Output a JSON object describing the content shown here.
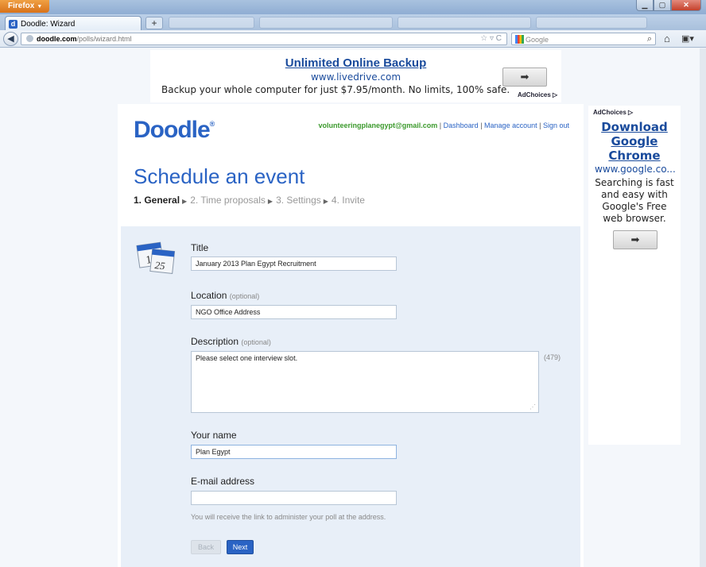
{
  "browser": {
    "menu_label": "Firefox",
    "active_tab_title": "Doodle: Wizard",
    "new_tab_symbol": "+",
    "url_domain": "doodle.com",
    "url_path": "/polls/wizard.html",
    "search_placeholder": "Google"
  },
  "top_ad": {
    "title": "Unlimited Online Backup",
    "url": "www.livedrive.com",
    "description": "Backup your whole computer for just $7.95/month. No limits, 100% safe.",
    "adchoices": "AdChoices"
  },
  "doodle": {
    "logo": "Doodle",
    "account": {
      "email": "volunteeringplanegypt@gmail.com",
      "dashboard": "Dashboard",
      "manage": "Manage account",
      "signout": "Sign out",
      "sep": "|"
    },
    "heading": "Schedule an event",
    "steps": [
      "1. General",
      "2. Time proposals",
      "3. Settings",
      "4. Invite"
    ],
    "calendar_numbers": [
      "1",
      "25"
    ],
    "form": {
      "title_label": "Title",
      "title_value": "January 2013 Plan Egypt Recruitment",
      "location_label": "Location",
      "location_optional": "(optional)",
      "location_value": "NGO Office Address",
      "description_label": "Description",
      "description_optional": "(optional)",
      "description_value": "Please select one interview slot.",
      "description_count": "(479)",
      "name_label": "Your name",
      "name_value": "Plan Egypt",
      "email_label": "E-mail address",
      "email_value": "",
      "email_hint": "You will receive the link to administer your poll at the address.",
      "back_label": "Back",
      "next_label": "Next"
    }
  },
  "side_ad": {
    "adchoices": "AdChoices",
    "title": "Download Google Chrome",
    "url": "www.google.co...",
    "description": "Searching is fast and easy with Google's Free web browser."
  },
  "colors": {
    "doodle_blue": "#2a63c4",
    "email_green": "#3c9a2d",
    "ad_link_blue": "#1a4b9c"
  }
}
